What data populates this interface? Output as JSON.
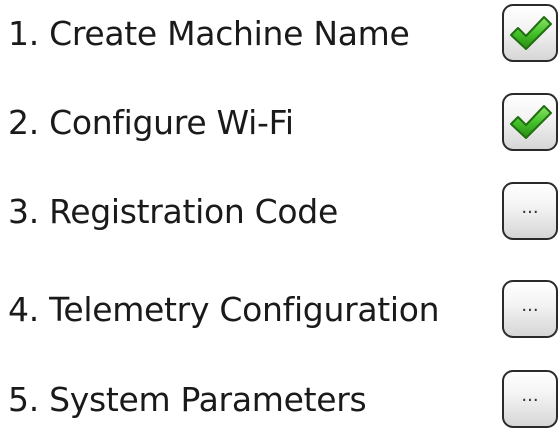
{
  "steps": [
    {
      "label": "1. Create Machine Name",
      "status": "complete",
      "icon": "checkmark-icon"
    },
    {
      "label": "2. Configure Wi-Fi",
      "status": "complete",
      "icon": "checkmark-icon"
    },
    {
      "label": "3. Registration Code",
      "status": "pending",
      "icon_text": "...",
      "icon": "ellipsis-icon"
    },
    {
      "label": "4. Telemetry Configuration",
      "status": "pending",
      "icon_text": "...",
      "icon": "ellipsis-icon"
    },
    {
      "label": "5. System Parameters",
      "status": "pending",
      "icon_text": "...",
      "icon": "ellipsis-icon"
    }
  ],
  "colors": {
    "check_green": "#3fbf2a",
    "check_green_dark": "#1f7a12",
    "box_border": "#2a2a2a",
    "text": "#1a1a1a"
  }
}
